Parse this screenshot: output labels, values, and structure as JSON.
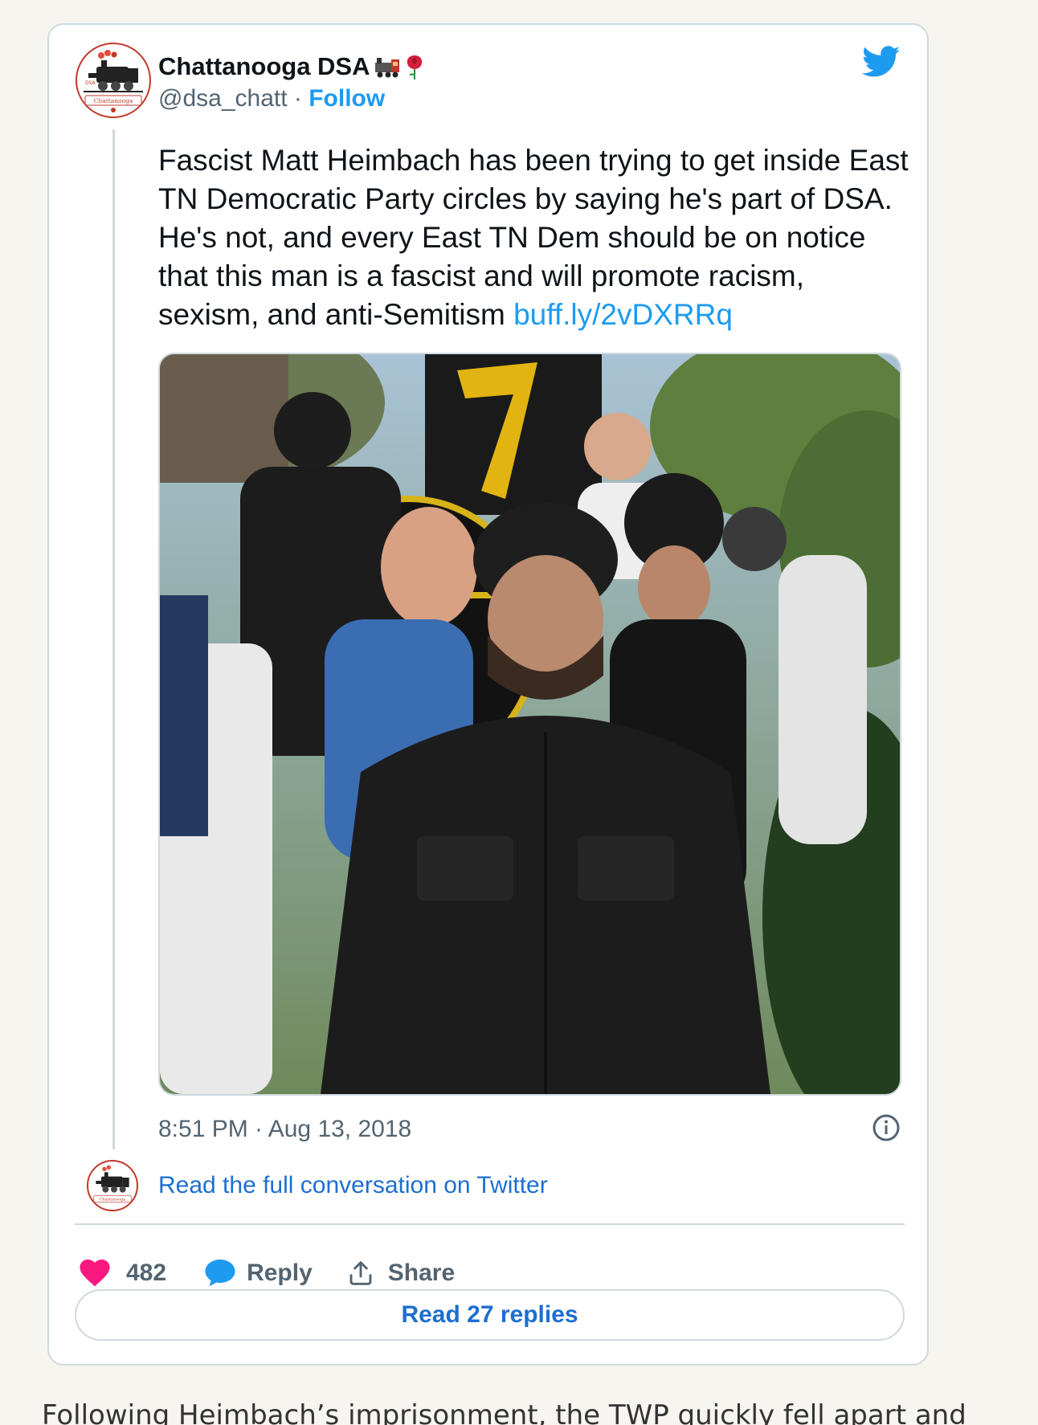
{
  "tweet": {
    "display_name": "Chattanooga DSA",
    "handle": "@dsa_chatt",
    "separator": "·",
    "follow_label": "Follow",
    "text": "Fascist Matt Heimbach has been trying to get inside East TN Democratic Party circles by saying he's part of DSA. He's not, and every East TN Dem should be on notice that this man is a fascist and will promote racism, sexism, and anti-Semitism ",
    "link_text": "buff.ly/2vDXRRq",
    "timestamp": "8:51 PM · Aug 13, 2018",
    "read_full_label": "Read the full conversation on Twitter",
    "like_count": "482",
    "reply_label": "Reply",
    "share_label": "Share",
    "read_replies_label": "Read 27 replies",
    "avatar_text": "Chattanooga",
    "avatar_small_text": "Chattanooga"
  },
  "article": {
    "text_fragment": "Following Heimbach’s imprisonment, the TWP quickly fell apart and"
  },
  "icons": {
    "name_emoji": [
      "train-icon",
      "rose-icon"
    ],
    "brand": "twitter-bird-icon",
    "like": "heart-icon",
    "reply": "speech-bubble-icon",
    "share": "share-upload-icon",
    "info": "info-icon"
  },
  "colors": {
    "twitter_blue": "#1d9bf0",
    "link_blue": "#1d6fd0",
    "heart_pink": "#f91880",
    "text_primary": "#0f1419",
    "text_secondary": "#536471",
    "border": "#cfd9de"
  }
}
